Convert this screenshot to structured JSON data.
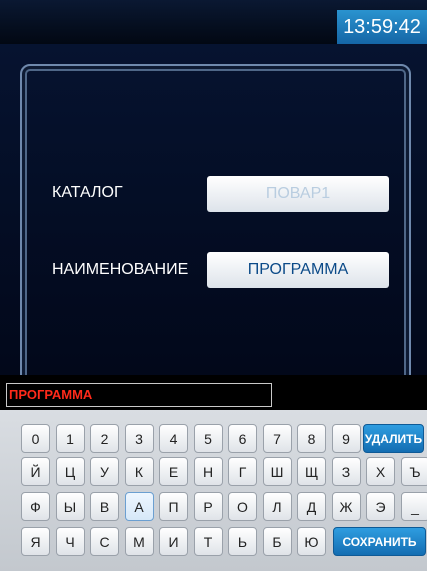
{
  "header": {
    "time": "13:59:42"
  },
  "form": {
    "catalog_label": "КАТАЛОГ",
    "catalog_value": "ПОВАР1",
    "name_label": "НАИМЕНОВАНИЕ",
    "name_value": "ПРОГРАММА"
  },
  "editor": {
    "text": "ПРОГРАММА"
  },
  "keyboard": {
    "row1": [
      "0",
      "1",
      "2",
      "3",
      "4",
      "5",
      "6",
      "7",
      "8",
      "9"
    ],
    "row2": [
      "Й",
      "Ц",
      "У",
      "К",
      "Е",
      "Н",
      "Г",
      "Ш",
      "Щ",
      "З",
      "Х",
      "Ъ"
    ],
    "row3": [
      "Ф",
      "Ы",
      "В",
      "А",
      "П",
      "Р",
      "О",
      "Л",
      "Д",
      "Ж",
      "Э",
      "_"
    ],
    "row4": [
      "Я",
      "Ч",
      "С",
      "М",
      "И",
      "Т",
      "Ь",
      "Б",
      "Ю"
    ],
    "delete_label": "УДАЛИТЬ",
    "save_label": "СОХРАНИТЬ"
  },
  "colors": {
    "accent": "#1f86c8",
    "editor_text": "#ff2a1a"
  }
}
